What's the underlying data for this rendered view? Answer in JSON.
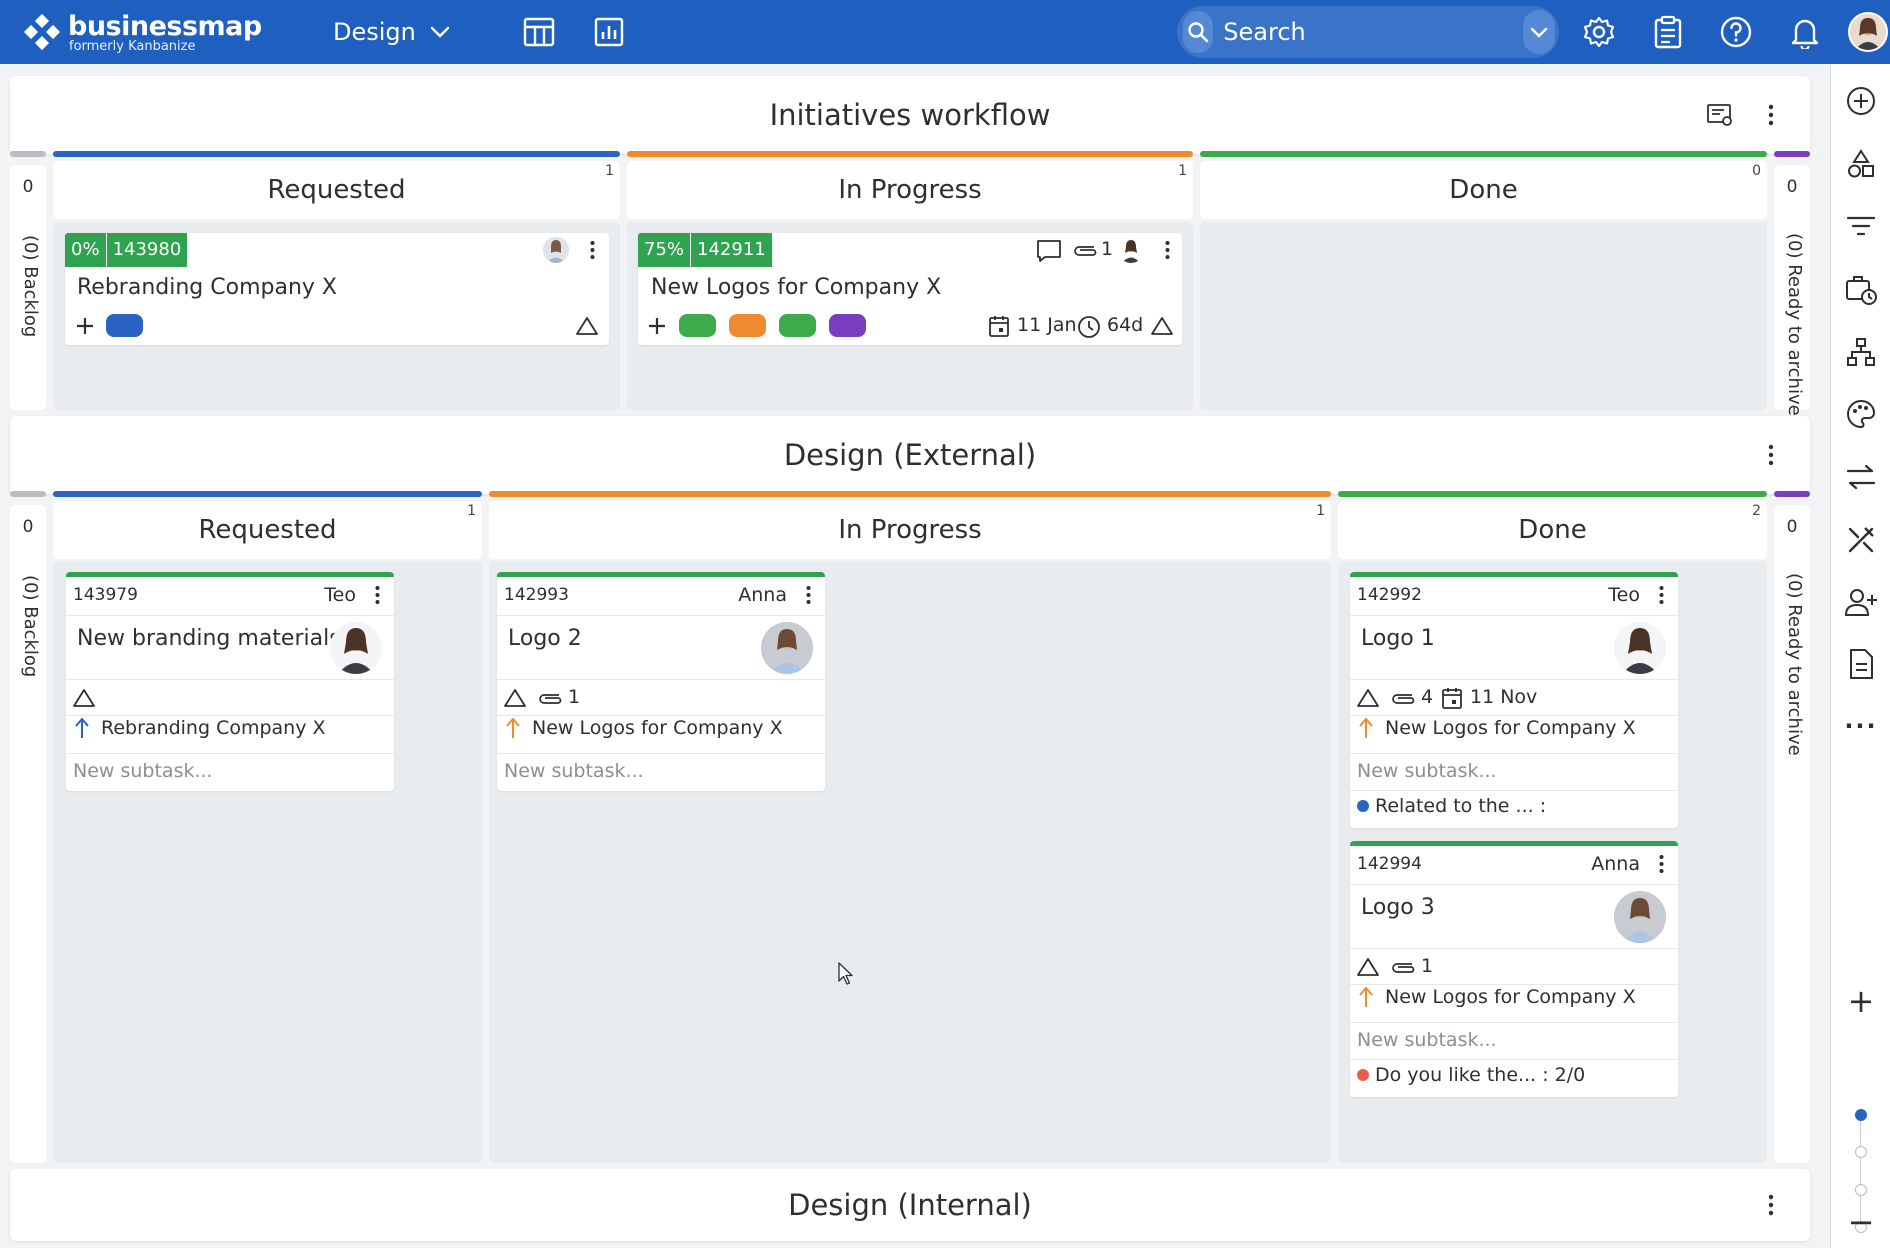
{
  "topbar": {
    "brand": "businessmap",
    "brand_sub": "formerly Kanbanize",
    "workspace": "Design",
    "search_placeholder": "Search",
    "bg": "#1f5fbf"
  },
  "colors": {
    "requested": "#2a63c1",
    "in_progress": "#f08a2e",
    "done": "#3daa4b",
    "archive": "#7b3cc2",
    "progress_green": "#2fa34f"
  },
  "icons": {
    "workspace_chevron": "chevron-down-icon",
    "board_view": "table-icon",
    "analytics": "chart-icon",
    "settings": "gear-icon",
    "clipboard": "clipboard-icon",
    "help": "help-icon",
    "notifications": "bell-icon"
  },
  "rail": {
    "zoom_in": "+",
    "zoom_out": "−",
    "more": "···"
  },
  "initiatives": {
    "title": "Initiatives workflow",
    "backlog_count": "0",
    "backlog_label": "(0) Backlog",
    "archive_count": "0",
    "archive_label": "(0) Ready to archive",
    "columns": [
      {
        "name": "Requested",
        "count": "1"
      },
      {
        "name": "In Progress",
        "count": "1"
      },
      {
        "name": "Done",
        "count": "0"
      }
    ],
    "cards": [
      {
        "progress": "0%",
        "id": "143980",
        "title": "Rebranding Company X"
      },
      {
        "progress": "75%",
        "id": "142911",
        "title": "New Logos for Company X",
        "attachments": "1",
        "deadline": "11 Jan",
        "age": "64d"
      }
    ]
  },
  "design_external": {
    "title": "Design (External)",
    "backlog_count": "0",
    "backlog_label": "(0) Backlog",
    "archive_count": "0",
    "archive_label": "(0) Ready to archive",
    "columns": [
      {
        "name": "Requested",
        "count": "1"
      },
      {
        "name": "In Progress",
        "count": "1"
      },
      {
        "name": "Done",
        "count": "2"
      }
    ],
    "cards": [
      {
        "id": "143979",
        "owner": "Teo",
        "title": "New branding materials",
        "parent": "Rebranding Company X",
        "parent_arrow_color": "#2a63c1",
        "new_subtask": "New subtask..."
      },
      {
        "id": "142993",
        "owner": "Anna",
        "title": "Logo 2",
        "attachments": "1",
        "parent": "New Logos for Company X",
        "parent_arrow_color": "#f08a2e",
        "new_subtask": "New subtask..."
      },
      {
        "id": "142992",
        "owner": "Teo",
        "title": "Logo 1",
        "attachments": "4",
        "deadline": "11 Nov",
        "parent": "New Logos for Company X",
        "parent_arrow_color": "#f08a2e",
        "new_subtask": "New subtask...",
        "checklist": "Related to the ... :",
        "checklist_color": "#2a63c1"
      },
      {
        "id": "142994",
        "owner": "Anna",
        "title": "Logo 3",
        "attachments": "1",
        "parent": "New Logos for Company X",
        "parent_arrow_color": "#f08a2e",
        "new_subtask": "New subtask...",
        "checklist": "Do you like the... : 2/0",
        "checklist_color": "#e8604c"
      }
    ]
  },
  "design_internal": {
    "title": "Design (Internal)"
  }
}
